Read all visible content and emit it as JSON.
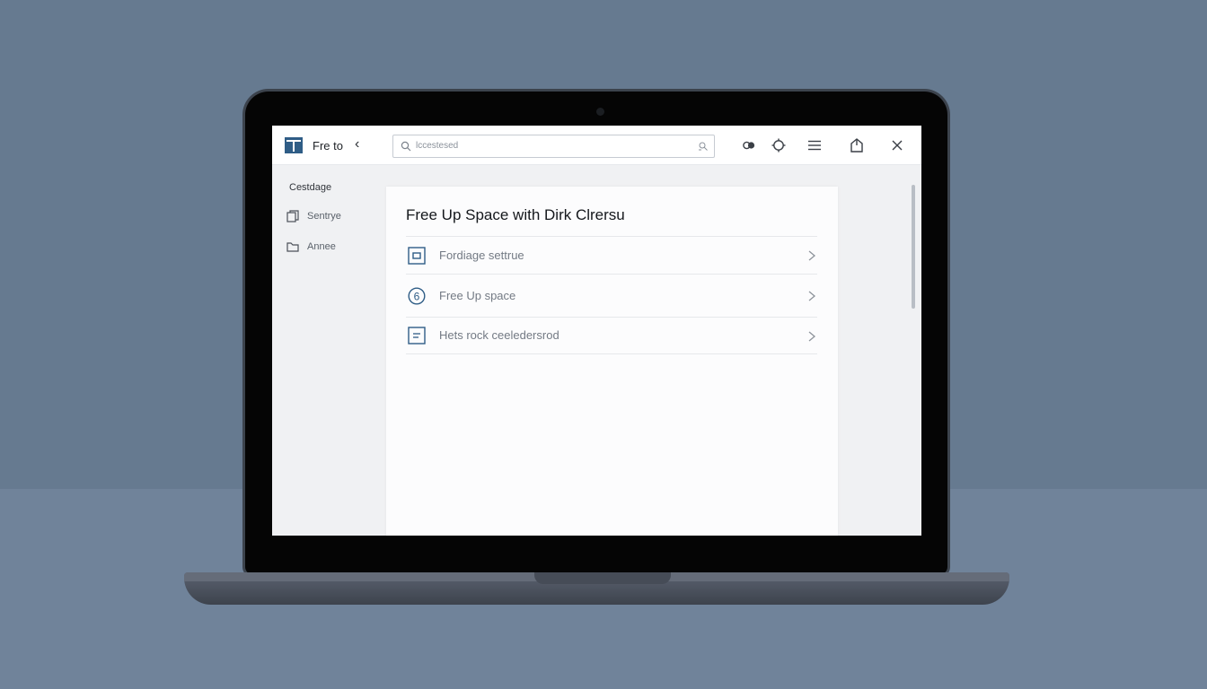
{
  "app": {
    "title": "Fre to",
    "back": "‹"
  },
  "search": {
    "value": "lccestesed"
  },
  "sidebar": {
    "heading": "Cestdage",
    "items": [
      {
        "label": "Sentrye",
        "icon": "copy-icon"
      },
      {
        "label": "Annee",
        "icon": "folder-icon"
      }
    ]
  },
  "toolbar": {
    "icons": [
      "toggle-icon",
      "gear-icon",
      "menu-icon",
      "share-icon",
      "close-icon"
    ]
  },
  "main": {
    "title": "Free Up Space with Dirk Clrersu",
    "rows": [
      {
        "label": "Fordiage settrue",
        "icon": "square-icon"
      },
      {
        "label": "Free Up space",
        "icon": "cleanup-icon"
      },
      {
        "label": "Hets rock ceeledersrod",
        "icon": "document-icon"
      }
    ]
  },
  "colors": {
    "background": "#667a90",
    "accent": "#2f5d86",
    "screen": "#f0f1f3"
  }
}
